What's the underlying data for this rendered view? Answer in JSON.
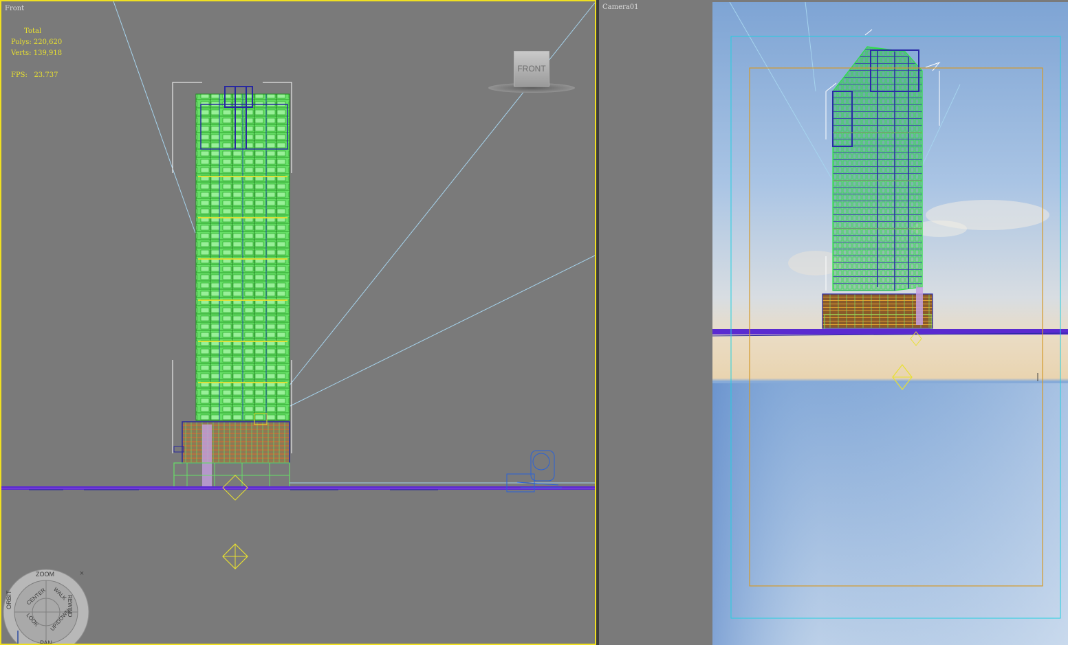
{
  "front_viewport": {
    "label": "Front",
    "stats": {
      "header": "Total",
      "polys_label": "Polys:",
      "polys_value": "220,620",
      "verts_label": "Verts:",
      "verts_value": "139,918",
      "fps_label": "FPS:",
      "fps_value": "23.737"
    },
    "viewcube_label": "FRONT"
  },
  "camera_viewport": {
    "label": "Camera01"
  },
  "steering_wheel": {
    "zoom": "ZOOM",
    "orbit": "ORBIT",
    "center": "CENTER",
    "walk": "WALK",
    "rewind": "REWIND",
    "look": "LOOK",
    "updown": "UP/DOWN",
    "pan": "PAN",
    "close": "×"
  },
  "colors": {
    "active_border": "#f0e020",
    "viewport_bg": "#7a7a7a",
    "wire_green": "#3cd23c",
    "wire_blue": "#2828a0",
    "wire_yellow": "#f0e020",
    "safe_frame_cyan": "#22d0e0",
    "safe_frame_orange": "#d49a2a"
  }
}
